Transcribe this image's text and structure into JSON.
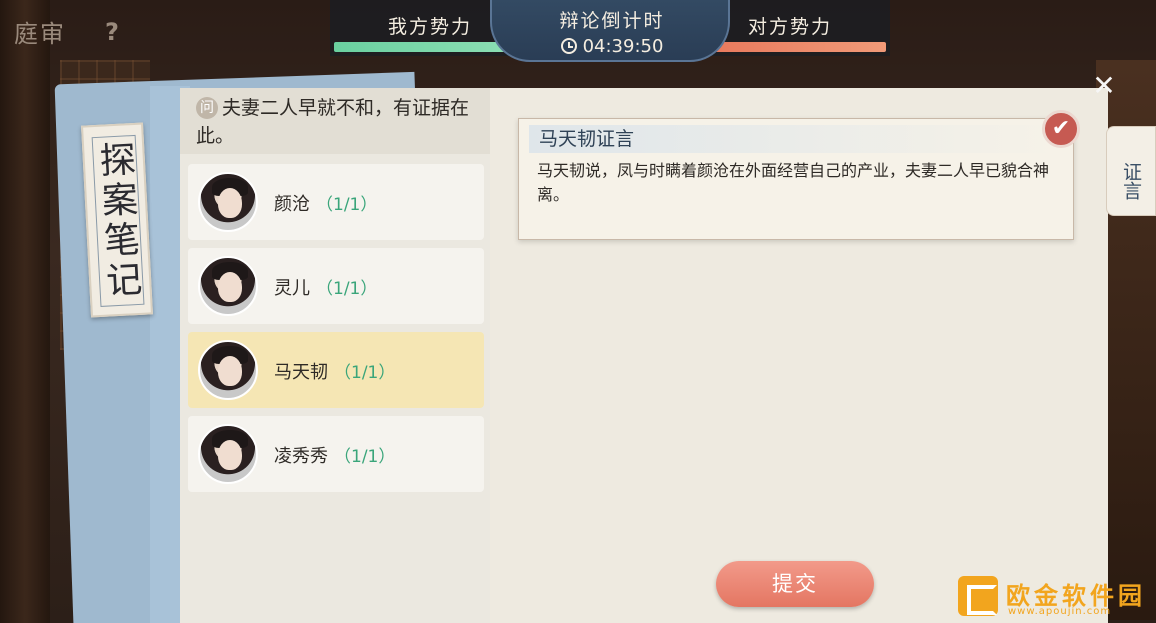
{
  "header": {
    "title": "庭审",
    "help_label": "?"
  },
  "hud": {
    "our_side_label": "我方势力",
    "opponent_side_label": "对方势力",
    "countdown_label": "辩论倒计时",
    "countdown_time": "04:39:50",
    "bar_colors": {
      "ours": "#6ad0a0",
      "opponent": "#e8765a"
    }
  },
  "notebook": {
    "label": "探案笔记"
  },
  "question": {
    "badge": "问",
    "text": "夫妻二人早就不和，有证据在此。"
  },
  "characters": [
    {
      "name": "颜沧",
      "count": "（1/1）",
      "selected": false
    },
    {
      "name": "灵儿",
      "count": "（1/1）",
      "selected": false
    },
    {
      "name": "马天韧",
      "count": "（1/1）",
      "selected": true
    },
    {
      "name": "凌秀秀",
      "count": "（1/1）",
      "selected": false
    }
  ],
  "testimony": {
    "title": "马天韧证言",
    "text": "马天韧说，凤与时瞒着颜沧在外面经营自己的产业，夫妻二人早已貌合神离。"
  },
  "side_tab": {
    "label": "证言"
  },
  "actions": {
    "submit_label": "提交"
  },
  "watermark": {
    "text": "欧金软件园",
    "sub": "www.apoujin.com"
  },
  "icons": {
    "close": "close-icon",
    "check": "check-icon",
    "clock": "clock-icon"
  }
}
